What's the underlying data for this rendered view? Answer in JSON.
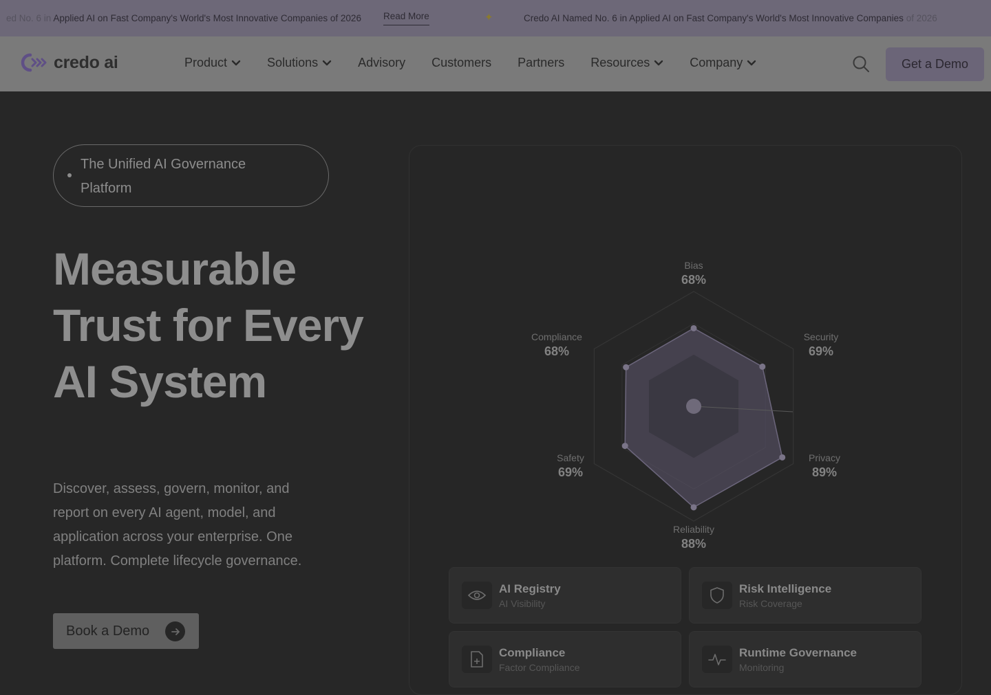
{
  "announcement": {
    "msg1_fade": "ed No. 6 in ",
    "msg1": "Applied AI on Fast Company's World's Most Innovative Companies of 2026",
    "read_more": "Read More",
    "spark_icon": "sparkle-icon",
    "msg2": "Credo AI Named No. 6 in Applied AI on Fast Company's World's Most Innovative Companies ",
    "msg2_fade": "of 2026"
  },
  "nav": {
    "logo_text": "credo ai",
    "items": [
      {
        "label": "Product",
        "dropdown": true
      },
      {
        "label": "Solutions",
        "dropdown": true
      },
      {
        "label": "Advisory",
        "dropdown": false
      },
      {
        "label": "Customers",
        "dropdown": false
      },
      {
        "label": "Partners",
        "dropdown": false
      },
      {
        "label": "Resources",
        "dropdown": true
      },
      {
        "label": "Company",
        "dropdown": true
      }
    ],
    "search_icon": "search-icon",
    "cta": "Get a Demo"
  },
  "hero": {
    "pill": "The Unified AI Governance Platform",
    "headline": "Measurable Trust for Every AI System",
    "subcopy": "Discover, assess, govern, monitor, and report on every AI agent, model, and application across your enterprise. One platform. Complete lifecycle governance.",
    "book_a": "Book a",
    "book_demo": "Demo"
  },
  "radar": {
    "axes": [
      {
        "label": "Bias",
        "value": "68%"
      },
      {
        "label": "Security",
        "value": "69%"
      },
      {
        "label": "Privacy",
        "value": "89%"
      },
      {
        "label": "Reliability",
        "value": "88%"
      },
      {
        "label": "Safety",
        "value": "69%"
      },
      {
        "label": "Compliance",
        "value": "68%"
      }
    ],
    "scores": [
      68,
      69,
      89,
      88,
      69,
      68
    ]
  },
  "cards": [
    {
      "title": "AI Registry",
      "sub": "AI Visibility",
      "icon": "eye-icon"
    },
    {
      "title": "Risk Intelligence",
      "sub": "Risk Coverage",
      "icon": "shield-icon"
    },
    {
      "title": "Compliance",
      "sub": "Factor Compliance",
      "icon": "document-plus-icon"
    },
    {
      "title": "Runtime Governance",
      "sub": "Monitoring",
      "icon": "activity-icon"
    }
  ],
  "colors": {
    "accent": "#6b6578",
    "background": "#272727"
  }
}
